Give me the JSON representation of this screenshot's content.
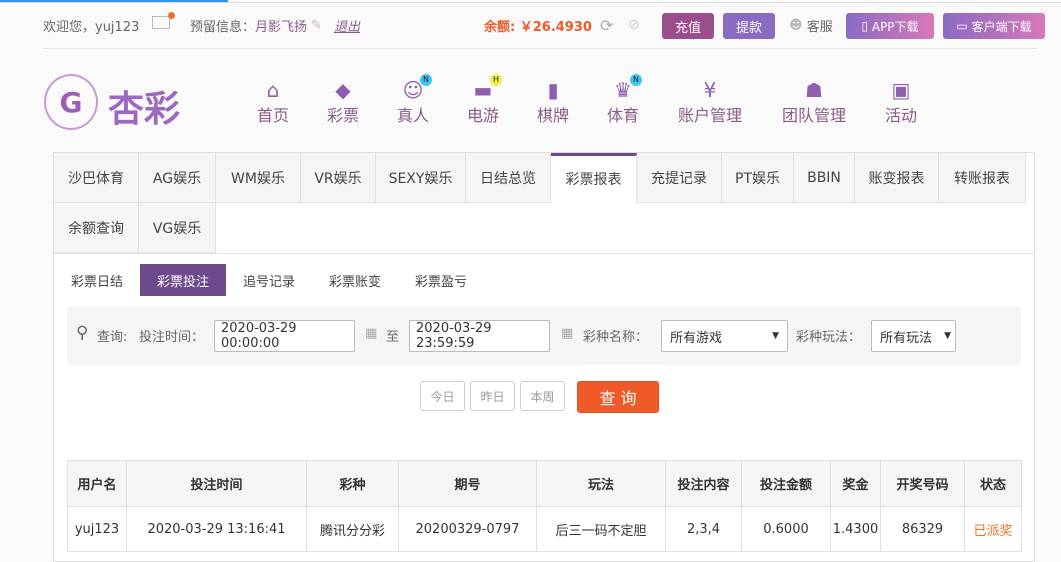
{
  "header": {
    "welcome": "欢迎您，yuj123",
    "reserved_label": "预留信息：",
    "reserved_value": "月影飞扬",
    "logout": "退出",
    "balance_label": "余额:",
    "balance_value": "￥26.4930",
    "recharge": "充值",
    "withdraw": "提款",
    "service": "客服",
    "app_download": "APP下载",
    "client_download": "客户端下载"
  },
  "logo": "杏彩",
  "nav": [
    {
      "label": "首页",
      "icon": "home-icon"
    },
    {
      "label": "彩票",
      "icon": "ticket-icon"
    },
    {
      "label": "真人",
      "icon": "live-dealer-icon",
      "badge": "N"
    },
    {
      "label": "电游",
      "icon": "gamepad-icon",
      "badge": "H"
    },
    {
      "label": "棋牌",
      "icon": "cards-icon"
    },
    {
      "label": "体育",
      "icon": "trophy-icon",
      "badge": "N"
    },
    {
      "label": "账户管理",
      "icon": "yen-coin-icon"
    },
    {
      "label": "团队管理",
      "icon": "team-icon"
    },
    {
      "label": "活动",
      "icon": "gift-icon"
    }
  ],
  "tabs": [
    "沙巴体育",
    "AG娱乐",
    "WM娱乐",
    "VR娱乐",
    "SEXY娱乐",
    "日结总览",
    "彩票报表",
    "充提记录",
    "PT娱乐",
    "BBIN",
    "账变报表",
    "转账报表",
    "余额查询",
    "VG娱乐"
  ],
  "subtabs": [
    "彩票日结",
    "彩票投注",
    "追号记录",
    "彩票账变",
    "彩票盈亏"
  ],
  "filter": {
    "query_label": "查询:",
    "time_label": "投注时间：",
    "start": "2020-03-29 00:00:00",
    "to": "至",
    "end": "2020-03-29 23:59:59",
    "game_label": "彩种名称：",
    "game_value": "所有游戏",
    "play_label": "彩种玩法：",
    "play_value": "所有玩法"
  },
  "buttons": {
    "today": "今日",
    "yesterday": "昨日",
    "week": "本周",
    "search": "查 询"
  },
  "table": {
    "headers": [
      "用户名",
      "投注时间",
      "彩种",
      "期号",
      "玩法",
      "投注内容",
      "投注金额",
      "奖金",
      "开奖号码",
      "状态"
    ],
    "rows": [
      [
        "yuj123",
        "2020-03-29 13:16:41",
        "腾讯分分彩",
        "20200329-0797",
        "后三一码不定胆",
        "2,3,4",
        "0.6000",
        "1.4300",
        "86329",
        "已派奖"
      ]
    ]
  },
  "colors": {
    "accent": "#6d4a8b",
    "orange": "#f05a28",
    "status": "#f07020"
  }
}
